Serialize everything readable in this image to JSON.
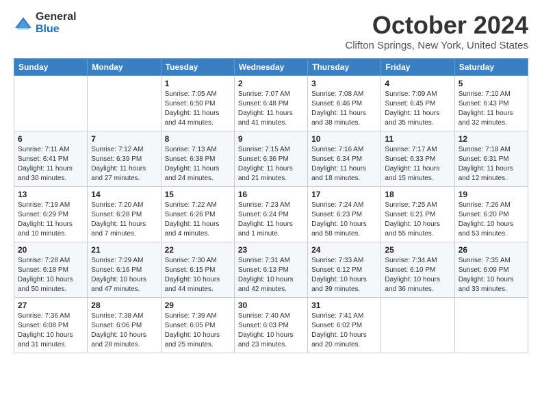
{
  "logo": {
    "general": "General",
    "blue": "Blue"
  },
  "title": "October 2024",
  "location": "Clifton Springs, New York, United States",
  "headers": [
    "Sunday",
    "Monday",
    "Tuesday",
    "Wednesday",
    "Thursday",
    "Friday",
    "Saturday"
  ],
  "weeks": [
    [
      {
        "day": "",
        "sunrise": "",
        "sunset": "",
        "daylight": ""
      },
      {
        "day": "",
        "sunrise": "",
        "sunset": "",
        "daylight": ""
      },
      {
        "day": "1",
        "sunrise": "Sunrise: 7:05 AM",
        "sunset": "Sunset: 6:50 PM",
        "daylight": "Daylight: 11 hours and 44 minutes."
      },
      {
        "day": "2",
        "sunrise": "Sunrise: 7:07 AM",
        "sunset": "Sunset: 6:48 PM",
        "daylight": "Daylight: 11 hours and 41 minutes."
      },
      {
        "day": "3",
        "sunrise": "Sunrise: 7:08 AM",
        "sunset": "Sunset: 6:46 PM",
        "daylight": "Daylight: 11 hours and 38 minutes."
      },
      {
        "day": "4",
        "sunrise": "Sunrise: 7:09 AM",
        "sunset": "Sunset: 6:45 PM",
        "daylight": "Daylight: 11 hours and 35 minutes."
      },
      {
        "day": "5",
        "sunrise": "Sunrise: 7:10 AM",
        "sunset": "Sunset: 6:43 PM",
        "daylight": "Daylight: 11 hours and 32 minutes."
      }
    ],
    [
      {
        "day": "6",
        "sunrise": "Sunrise: 7:11 AM",
        "sunset": "Sunset: 6:41 PM",
        "daylight": "Daylight: 11 hours and 30 minutes."
      },
      {
        "day": "7",
        "sunrise": "Sunrise: 7:12 AM",
        "sunset": "Sunset: 6:39 PM",
        "daylight": "Daylight: 11 hours and 27 minutes."
      },
      {
        "day": "8",
        "sunrise": "Sunrise: 7:13 AM",
        "sunset": "Sunset: 6:38 PM",
        "daylight": "Daylight: 11 hours and 24 minutes."
      },
      {
        "day": "9",
        "sunrise": "Sunrise: 7:15 AM",
        "sunset": "Sunset: 6:36 PM",
        "daylight": "Daylight: 11 hours and 21 minutes."
      },
      {
        "day": "10",
        "sunrise": "Sunrise: 7:16 AM",
        "sunset": "Sunset: 6:34 PM",
        "daylight": "Daylight: 11 hours and 18 minutes."
      },
      {
        "day": "11",
        "sunrise": "Sunrise: 7:17 AM",
        "sunset": "Sunset: 6:33 PM",
        "daylight": "Daylight: 11 hours and 15 minutes."
      },
      {
        "day": "12",
        "sunrise": "Sunrise: 7:18 AM",
        "sunset": "Sunset: 6:31 PM",
        "daylight": "Daylight: 11 hours and 12 minutes."
      }
    ],
    [
      {
        "day": "13",
        "sunrise": "Sunrise: 7:19 AM",
        "sunset": "Sunset: 6:29 PM",
        "daylight": "Daylight: 11 hours and 10 minutes."
      },
      {
        "day": "14",
        "sunrise": "Sunrise: 7:20 AM",
        "sunset": "Sunset: 6:28 PM",
        "daylight": "Daylight: 11 hours and 7 minutes."
      },
      {
        "day": "15",
        "sunrise": "Sunrise: 7:22 AM",
        "sunset": "Sunset: 6:26 PM",
        "daylight": "Daylight: 11 hours and 4 minutes."
      },
      {
        "day": "16",
        "sunrise": "Sunrise: 7:23 AM",
        "sunset": "Sunset: 6:24 PM",
        "daylight": "Daylight: 11 hours and 1 minute."
      },
      {
        "day": "17",
        "sunrise": "Sunrise: 7:24 AM",
        "sunset": "Sunset: 6:23 PM",
        "daylight": "Daylight: 10 hours and 58 minutes."
      },
      {
        "day": "18",
        "sunrise": "Sunrise: 7:25 AM",
        "sunset": "Sunset: 6:21 PM",
        "daylight": "Daylight: 10 hours and 55 minutes."
      },
      {
        "day": "19",
        "sunrise": "Sunrise: 7:26 AM",
        "sunset": "Sunset: 6:20 PM",
        "daylight": "Daylight: 10 hours and 53 minutes."
      }
    ],
    [
      {
        "day": "20",
        "sunrise": "Sunrise: 7:28 AM",
        "sunset": "Sunset: 6:18 PM",
        "daylight": "Daylight: 10 hours and 50 minutes."
      },
      {
        "day": "21",
        "sunrise": "Sunrise: 7:29 AM",
        "sunset": "Sunset: 6:16 PM",
        "daylight": "Daylight: 10 hours and 47 minutes."
      },
      {
        "day": "22",
        "sunrise": "Sunrise: 7:30 AM",
        "sunset": "Sunset: 6:15 PM",
        "daylight": "Daylight: 10 hours and 44 minutes."
      },
      {
        "day": "23",
        "sunrise": "Sunrise: 7:31 AM",
        "sunset": "Sunset: 6:13 PM",
        "daylight": "Daylight: 10 hours and 42 minutes."
      },
      {
        "day": "24",
        "sunrise": "Sunrise: 7:33 AM",
        "sunset": "Sunset: 6:12 PM",
        "daylight": "Daylight: 10 hours and 39 minutes."
      },
      {
        "day": "25",
        "sunrise": "Sunrise: 7:34 AM",
        "sunset": "Sunset: 6:10 PM",
        "daylight": "Daylight: 10 hours and 36 minutes."
      },
      {
        "day": "26",
        "sunrise": "Sunrise: 7:35 AM",
        "sunset": "Sunset: 6:09 PM",
        "daylight": "Daylight: 10 hours and 33 minutes."
      }
    ],
    [
      {
        "day": "27",
        "sunrise": "Sunrise: 7:36 AM",
        "sunset": "Sunset: 6:08 PM",
        "daylight": "Daylight: 10 hours and 31 minutes."
      },
      {
        "day": "28",
        "sunrise": "Sunrise: 7:38 AM",
        "sunset": "Sunset: 6:06 PM",
        "daylight": "Daylight: 10 hours and 28 minutes."
      },
      {
        "day": "29",
        "sunrise": "Sunrise: 7:39 AM",
        "sunset": "Sunset: 6:05 PM",
        "daylight": "Daylight: 10 hours and 25 minutes."
      },
      {
        "day": "30",
        "sunrise": "Sunrise: 7:40 AM",
        "sunset": "Sunset: 6:03 PM",
        "daylight": "Daylight: 10 hours and 23 minutes."
      },
      {
        "day": "31",
        "sunrise": "Sunrise: 7:41 AM",
        "sunset": "Sunset: 6:02 PM",
        "daylight": "Daylight: 10 hours and 20 minutes."
      },
      {
        "day": "",
        "sunrise": "",
        "sunset": "",
        "daylight": ""
      },
      {
        "day": "",
        "sunrise": "",
        "sunset": "",
        "daylight": ""
      }
    ]
  ]
}
